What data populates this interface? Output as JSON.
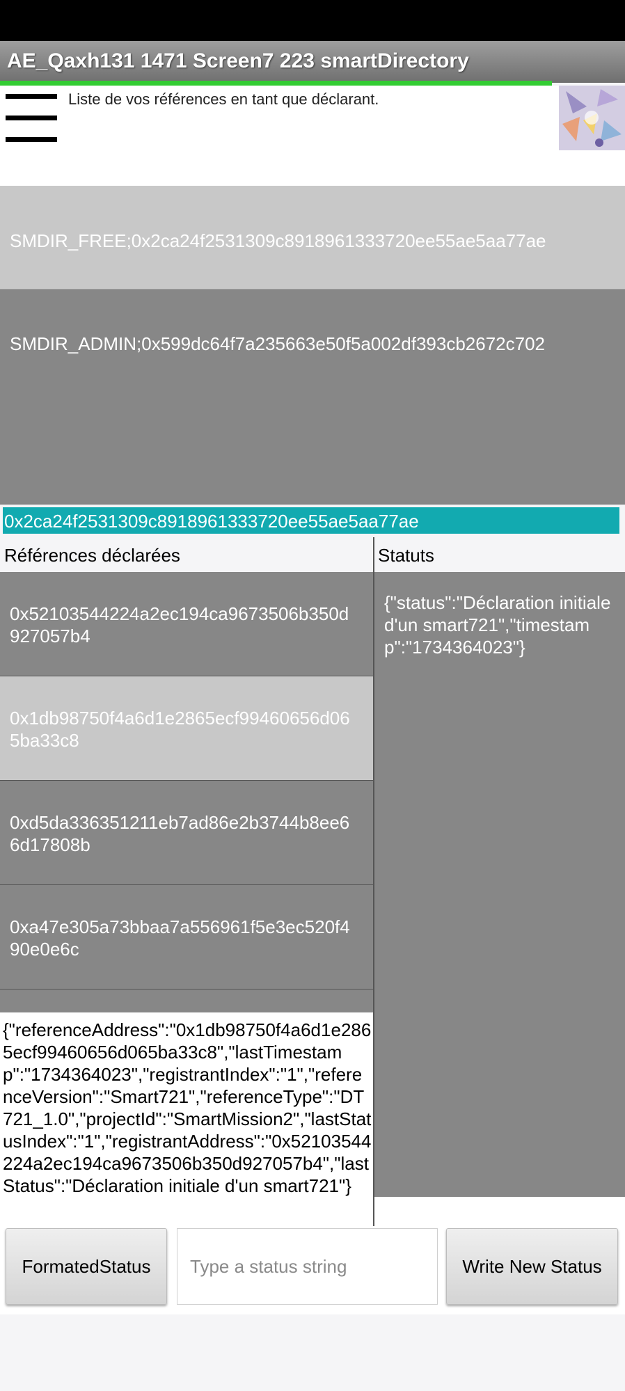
{
  "app": {
    "title": "AE_Qaxh131 1471 Screen7 223 smartDirectory",
    "header_caption": "Liste de vos références en tant que déclarant."
  },
  "references": [
    "SMDIR_FREE;0x2ca24f2531309c8918961333720ee55ae5aa77ae",
    "SMDIR_ADMIN;0x599dc64f7a235663e50f5a002df393cb2672c702"
  ],
  "selected_address": "0x2ca24f2531309c8918961333720ee55ae5aa77ae",
  "columns": {
    "declared_header": "Références déclarées",
    "status_header": "Statuts"
  },
  "declared_references": [
    "0x52103544224a2ec194ca9673506b350d927057b4",
    "0x1db98750f4a6d1e2865ecf99460656d065ba33c8",
    "0xd5da336351211eb7ad86e2b3744b8ee66d17808b",
    "0xa47e305a73bbaa7a556961f5e3ec520f490e0e6c"
  ],
  "selected_declared_index": 1,
  "status_json": "{\"status\":\"Déclaration initiale d'un smart721\",\"timestamp\":\"1734364023\"}",
  "details_json": "{\"referenceAddress\":\"0x1db98750f4a6d1e2865ecf99460656d065ba33c8\",\"lastTimestamp\":\"1734364023\",\"registrantIndex\":\"1\",\"referenceVersion\":\"Smart721\",\"referenceType\":\"DT721_1.0\",\"projectId\":\"SmartMission2\",\"lastStatusIndex\":\"1\",\"registrantAddress\":\"0x52103544224a2ec194ca9673506b350d927057b4\",\"lastStatus\":\"Déclaration initiale d'un smart721\"}",
  "actions": {
    "formatted_status_label": "FormatedStatus",
    "status_input_placeholder": "Type a status string",
    "write_status_label": "Write New Status"
  },
  "colors": {
    "accent_teal": "#12aab0",
    "progress_green": "#33cc33",
    "row_dark": "#878787",
    "row_light": "#c8c8c8"
  }
}
